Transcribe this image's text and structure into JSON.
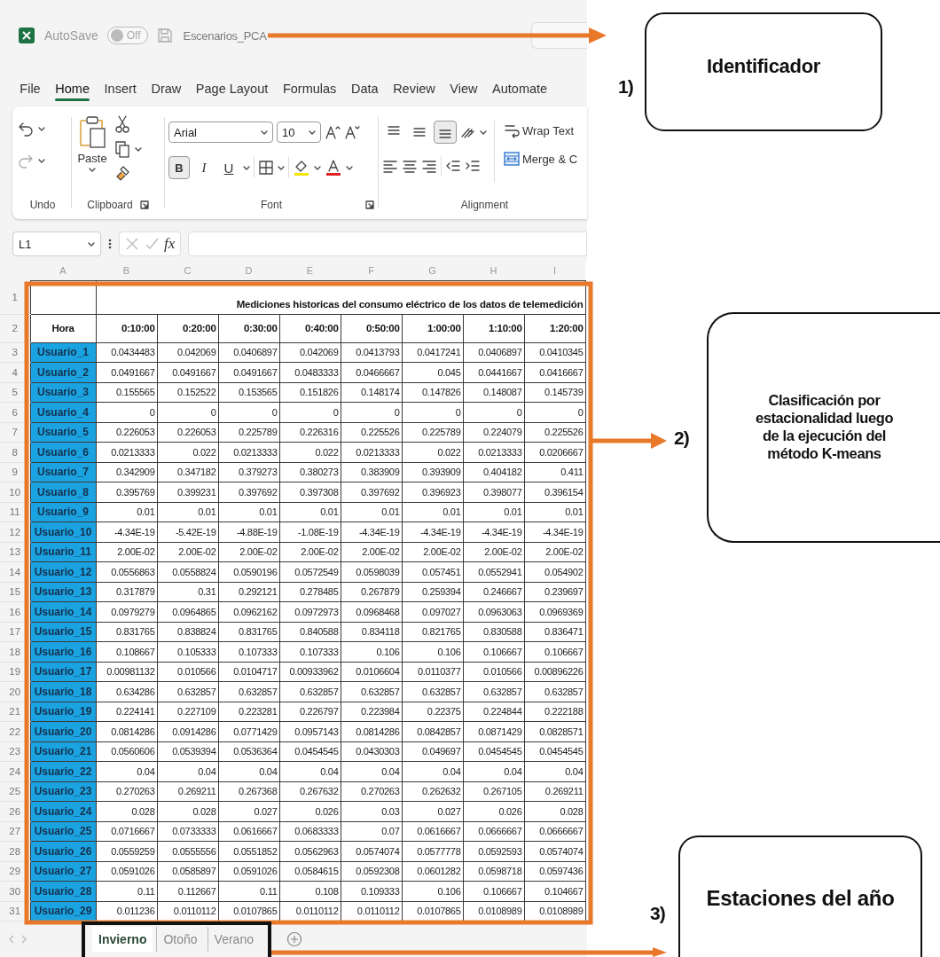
{
  "title_bar": {
    "autosave_label": "AutoSave",
    "autosave": {
      "label": "Off",
      "on": false
    },
    "file_name": "Escenarios_PCA"
  },
  "menu_tabs": [
    {
      "label": "File",
      "selected": false
    },
    {
      "label": "Home",
      "selected": true
    },
    {
      "label": "Insert",
      "selected": false
    },
    {
      "label": "Draw",
      "selected": false
    },
    {
      "label": "Page Layout",
      "selected": false
    },
    {
      "label": "Formulas",
      "selected": false
    },
    {
      "label": "Data",
      "selected": false
    },
    {
      "label": "Review",
      "selected": false
    },
    {
      "label": "View",
      "selected": false
    },
    {
      "label": "Automate",
      "selected": false
    }
  ],
  "ribbon": {
    "undo": {
      "group_label": "Undo"
    },
    "clipboard": {
      "paste_label": "Paste",
      "group_label": "Clipboard"
    },
    "font": {
      "font_name": "Arial",
      "font_size": "10",
      "group_label": "Font",
      "format_buttons": [
        {
          "label": "B",
          "kind": "bold",
          "pressed": true
        },
        {
          "label": "I",
          "kind": "italic",
          "pressed": false
        },
        {
          "label": "U",
          "kind": "underline",
          "pressed": false
        }
      ]
    },
    "alignment": {
      "group_label": "Alignment",
      "wrap_text": "Wrap Text",
      "merge": "Merge & C",
      "vertical_buttons": [
        {
          "kind": "top",
          "pressed": false
        },
        {
          "kind": "middle",
          "pressed": false
        },
        {
          "kind": "bottom",
          "pressed": true
        }
      ]
    }
  },
  "formula_bar": {
    "cell_ref": "L1",
    "function_label": "fx"
  },
  "column_letters": [
    "A",
    "B",
    "C",
    "D",
    "E",
    "F",
    "G",
    "H",
    "I"
  ],
  "row_numbers": [
    "1",
    "2",
    "3",
    "4",
    "5",
    "6",
    "7",
    "8",
    "9",
    "10",
    "11",
    "12",
    "13",
    "14",
    "15",
    "16",
    "17",
    "18",
    "19",
    "20",
    "21",
    "22",
    "23",
    "24",
    "25",
    "26",
    "27",
    "28",
    "29",
    "30",
    "31"
  ],
  "sheet": {
    "title": "Mediciones historicas del consumo eléctrico de los datos de telemedición",
    "row_header": "Hora",
    "times": [
      "0:10:00",
      "0:20:00",
      "0:30:00",
      "0:40:00",
      "0:50:00",
      "1:00:00",
      "1:10:00",
      "1:20:00"
    ],
    "rows": [
      {
        "name": "Usuario_1",
        "values": [
          "0.0434483",
          "0.042069",
          "0.0406897",
          "0.042069",
          "0.0413793",
          "0.0417241",
          "0.0406897",
          "0.0410345"
        ]
      },
      {
        "name": "Usuario_2",
        "values": [
          "0.0491667",
          "0.0491667",
          "0.0491667",
          "0.0483333",
          "0.0466667",
          "0.045",
          "0.0441667",
          "0.0416667"
        ]
      },
      {
        "name": "Usuario_3",
        "values": [
          "0.155565",
          "0.152522",
          "0.153565",
          "0.151826",
          "0.148174",
          "0.147826",
          "0.148087",
          "0.145739"
        ]
      },
      {
        "name": "Usuario_4",
        "values": [
          "0",
          "0",
          "0",
          "0",
          "0",
          "0",
          "0",
          "0"
        ]
      },
      {
        "name": "Usuario_5",
        "values": [
          "0.226053",
          "0.226053",
          "0.225789",
          "0.226316",
          "0.225526",
          "0.225789",
          "0.224079",
          "0.225526"
        ]
      },
      {
        "name": "Usuario_6",
        "values": [
          "0.0213333",
          "0.022",
          "0.0213333",
          "0.022",
          "0.0213333",
          "0.022",
          "0.0213333",
          "0.0206667"
        ]
      },
      {
        "name": "Usuario_7",
        "values": [
          "0.342909",
          "0.347182",
          "0.379273",
          "0.380273",
          "0.383909",
          "0.393909",
          "0.404182",
          "0.411"
        ]
      },
      {
        "name": "Usuario_8",
        "values": [
          "0.395769",
          "0.399231",
          "0.397692",
          "0.397308",
          "0.397692",
          "0.396923",
          "0.398077",
          "0.396154"
        ]
      },
      {
        "name": "Usuario_9",
        "values": [
          "0.01",
          "0.01",
          "0.01",
          "0.01",
          "0.01",
          "0.01",
          "0.01",
          "0.01"
        ]
      },
      {
        "name": "Usuario_10",
        "values": [
          "-4.34E-19",
          "-5.42E-19",
          "-4.88E-19",
          "-1.08E-19",
          "-4.34E-19",
          "-4.34E-19",
          "-4.34E-19",
          "-4.34E-19"
        ]
      },
      {
        "name": "Usuario_11",
        "values": [
          "2.00E-02",
          "2.00E-02",
          "2.00E-02",
          "2.00E-02",
          "2.00E-02",
          "2.00E-02",
          "2.00E-02",
          "2.00E-02"
        ]
      },
      {
        "name": "Usuario_12",
        "values": [
          "0.0556863",
          "0.0558824",
          "0.0590196",
          "0.0572549",
          "0.0598039",
          "0.057451",
          "0.0552941",
          "0.054902"
        ]
      },
      {
        "name": "Usuario_13",
        "values": [
          "0.317879",
          "0.31",
          "0.292121",
          "0.278485",
          "0.267879",
          "0.259394",
          "0.246667",
          "0.239697"
        ]
      },
      {
        "name": "Usuario_14",
        "values": [
          "0.0979279",
          "0.0964865",
          "0.0962162",
          "0.0972973",
          "0.0968468",
          "0.097027",
          "0.0963063",
          "0.0969369"
        ]
      },
      {
        "name": "Usuario_15",
        "values": [
          "0.831765",
          "0.838824",
          "0.831765",
          "0.840588",
          "0.834118",
          "0.821765",
          "0.830588",
          "0.836471"
        ]
      },
      {
        "name": "Usuario_16",
        "values": [
          "0.108667",
          "0.105333",
          "0.107333",
          "0.107333",
          "0.106",
          "0.106",
          "0.106667",
          "0.106667"
        ]
      },
      {
        "name": "Usuario_17",
        "values": [
          "0.00981132",
          "0.010566",
          "0.0104717",
          "0.00933962",
          "0.0106604",
          "0.0110377",
          "0.010566",
          "0.00896226"
        ]
      },
      {
        "name": "Usuario_18",
        "values": [
          "0.634286",
          "0.632857",
          "0.632857",
          "0.632857",
          "0.632857",
          "0.632857",
          "0.632857",
          "0.632857"
        ]
      },
      {
        "name": "Usuario_19",
        "values": [
          "0.224141",
          "0.227109",
          "0.223281",
          "0.226797",
          "0.223984",
          "0.22375",
          "0.224844",
          "0.222188"
        ]
      },
      {
        "name": "Usuario_20",
        "values": [
          "0.0814286",
          "0.0914286",
          "0.0771429",
          "0.0957143",
          "0.0814286",
          "0.0842857",
          "0.0871429",
          "0.0828571"
        ]
      },
      {
        "name": "Usuario_21",
        "values": [
          "0.0560606",
          "0.0539394",
          "0.0536364",
          "0.0454545",
          "0.0430303",
          "0.049697",
          "0.0454545",
          "0.0454545"
        ]
      },
      {
        "name": "Usuario_22",
        "values": [
          "0.04",
          "0.04",
          "0.04",
          "0.04",
          "0.04",
          "0.04",
          "0.04",
          "0.04"
        ]
      },
      {
        "name": "Usuario_23",
        "values": [
          "0.270263",
          "0.269211",
          "0.267368",
          "0.267632",
          "0.270263",
          "0.262632",
          "0.267105",
          "0.269211"
        ]
      },
      {
        "name": "Usuario_24",
        "values": [
          "0.028",
          "0.028",
          "0.027",
          "0.026",
          "0.03",
          "0.027",
          "0.026",
          "0.028"
        ]
      },
      {
        "name": "Usuario_25",
        "values": [
          "0.0716667",
          "0.0733333",
          "0.0616667",
          "0.0683333",
          "0.07",
          "0.0616667",
          "0.0666667",
          "0.0666667"
        ]
      },
      {
        "name": "Usuario_26",
        "values": [
          "0.0559259",
          "0.0555556",
          "0.0551852",
          "0.0562963",
          "0.0574074",
          "0.0577778",
          "0.0592593",
          "0.0574074"
        ]
      },
      {
        "name": "Usuario_27",
        "values": [
          "0.0591026",
          "0.0585897",
          "0.0591026",
          "0.0584615",
          "0.0592308",
          "0.0601282",
          "0.0598718",
          "0.0597436"
        ]
      },
      {
        "name": "Usuario_28",
        "values": [
          "0.11",
          "0.112667",
          "0.11",
          "0.108",
          "0.109333",
          "0.106",
          "0.106667",
          "0.104667"
        ]
      },
      {
        "name": "Usuario_29",
        "values": [
          "0.011236",
          "0.0110112",
          "0.0107865",
          "0.0110112",
          "0.0110112",
          "0.0107865",
          "0.0108989",
          "0.0108989"
        ]
      }
    ]
  },
  "sheet_tabs": [
    {
      "label": "Invierno",
      "selected": true
    },
    {
      "label": "Otoño",
      "selected": false
    },
    {
      "label": "Verano",
      "selected": false
    }
  ],
  "annotations": [
    {
      "number": "1)",
      "text": "Identificador"
    },
    {
      "number": "2)",
      "text": "Clasificación por estacionalidad luego de la ejecución del método K-means"
    },
    {
      "number": "3)",
      "text": "Estaciones del año"
    }
  ]
}
